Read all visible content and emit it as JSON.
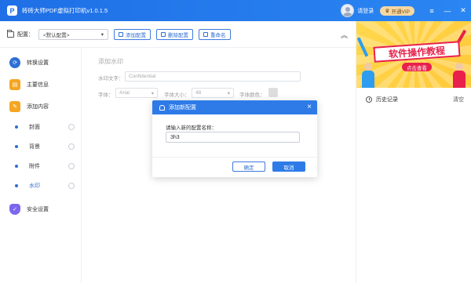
{
  "app": {
    "title": "砖砖大师PDF虚拟打印机v1.0.1.5",
    "logo_glyph": "P",
    "login_text": "请登录",
    "vip_label": "开通VIP",
    "window_controls": {
      "menu": "≡",
      "minimize": "—",
      "close": "✕"
    }
  },
  "toolbar": {
    "config_label": "配置：",
    "config_value": "<默认配置>",
    "buttons": [
      "添加配置",
      "删除配置",
      "重命名"
    ]
  },
  "sidebar": {
    "items": [
      {
        "label": "转换设置",
        "icon": "refresh-icon",
        "color": "#2f6fd4"
      },
      {
        "label": "主要信息",
        "icon": "info-card-icon",
        "color": "#f5a623"
      },
      {
        "label": "添加内容",
        "icon": "document-edit-icon",
        "color": "#f5a623"
      },
      {
        "label": "安全设置",
        "icon": "shield-icon",
        "color": "#7b68ee"
      }
    ],
    "sub_items": [
      "封面",
      "背景",
      "附件",
      "水印"
    ]
  },
  "main": {
    "section_title": "添加水印",
    "watermark_text_label": "水印文字：",
    "watermark_text_value": "Confidential",
    "font_label": "字体：",
    "font_value": "Arial",
    "size_label": "字体大小：",
    "size_value": "48",
    "color_label": "字体颜色："
  },
  "right_panel": {
    "banner_title": "软件操作教程",
    "banner_sub": "点击查看",
    "history_label": "历史记录",
    "clear_label": "清空"
  },
  "modal": {
    "title": "添加新配置",
    "prompt": "请输入新的配置名称：",
    "input_value": "3h3",
    "ok_label": "确定",
    "cancel_label": "取消"
  },
  "colors": {
    "accent": "#2e7be8",
    "banner_red": "#e8204b",
    "banner_yellow": "#ffd84d"
  }
}
